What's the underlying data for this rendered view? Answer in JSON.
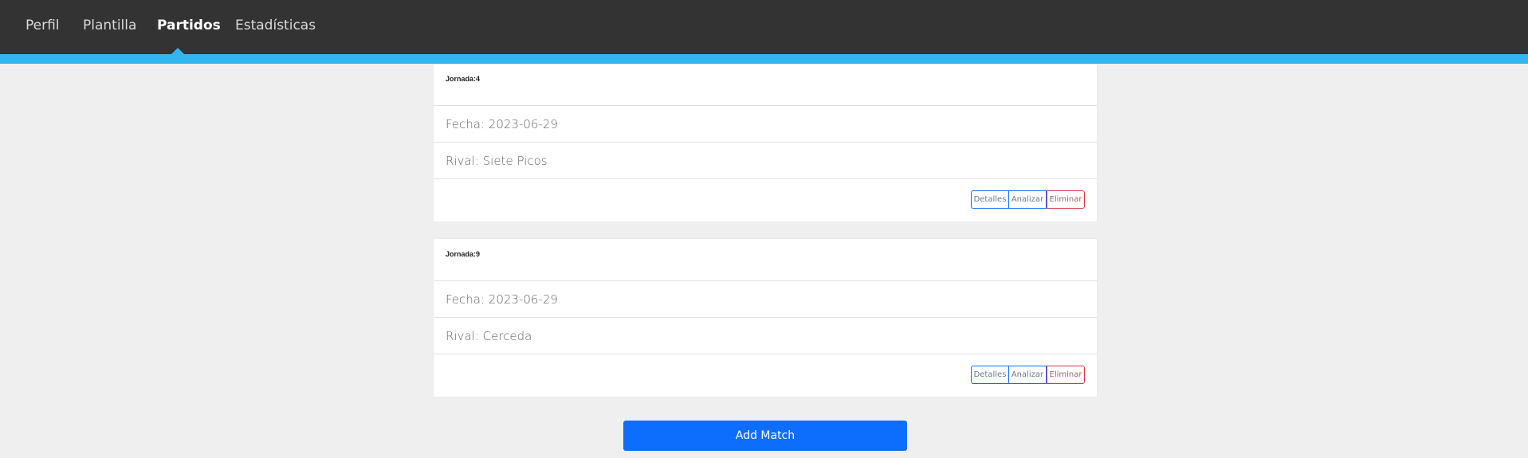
{
  "nav": {
    "items": [
      {
        "label": "Perfil"
      },
      {
        "label": "Plantilla"
      },
      {
        "label": "Partidos"
      },
      {
        "label": "Estadísticas"
      }
    ],
    "active_index": 2
  },
  "matches": [
    {
      "header": "Jornada:4",
      "fecha": "Fecha: 2023-06-29",
      "rival": "Rival: Siete Picos",
      "buttons": {
        "details": "Detalles",
        "analyze": "Analizar",
        "delete": "Eliminar"
      }
    },
    {
      "header": "Jornada:9",
      "fecha": "Fecha: 2023-06-29",
      "rival": "Rival: Cerceda",
      "buttons": {
        "details": "Detalles",
        "analyze": "Analizar",
        "delete": "Eliminar"
      }
    }
  ],
  "add_button": "Add Match",
  "colors": {
    "topbar": "#333333",
    "accent": "#33b5f0",
    "primary": "#0d6efd",
    "danger": "#dc3545",
    "background": "#efefef"
  }
}
